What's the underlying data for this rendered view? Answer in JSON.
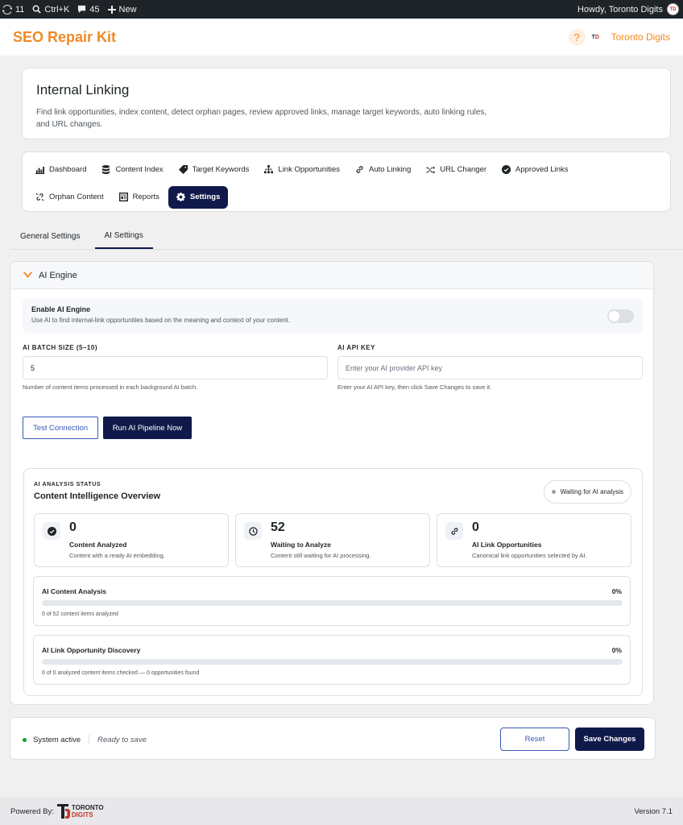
{
  "admin_bar": {
    "updates_count": "11",
    "search_label": "Ctrl+K",
    "comments_count": "45",
    "new_label": "New",
    "howdy": "Howdy, Toronto Digits"
  },
  "header": {
    "brand": "SEO Repair Kit",
    "help_glyph": "?",
    "account_name": "Toronto Digits"
  },
  "page": {
    "title": "Internal Linking",
    "description": "Find link opportunities, index content, detect orphan pages, review approved links, manage target keywords, auto linking rules, and URL changes."
  },
  "nav": {
    "row1": [
      {
        "label": "Dashboard",
        "icon": "chart-icon"
      },
      {
        "label": "Content Index",
        "icon": "database-icon"
      },
      {
        "label": "Target Keywords",
        "icon": "tag-icon"
      },
      {
        "label": "Link Opportunities",
        "icon": "sitemap-icon"
      },
      {
        "label": "Auto Linking",
        "icon": "link-icon"
      },
      {
        "label": "URL Changer",
        "icon": "shuffle-icon"
      },
      {
        "label": "Approved Links",
        "icon": "check-circle-icon"
      }
    ],
    "row2": [
      {
        "label": "Orphan Content",
        "icon": "broken-link-icon"
      },
      {
        "label": "Reports",
        "icon": "report-icon"
      },
      {
        "label": "Settings",
        "icon": "gear-icon"
      }
    ]
  },
  "subtabs": [
    "General Settings",
    "AI Settings"
  ],
  "ai_engine": {
    "heading": "AI Engine",
    "enable_title": "Enable AI Engine",
    "enable_desc": "Use AI to find internal-link opportunities based on the meaning and context of your content.",
    "enabled": false,
    "batch_label": "AI BATCH SIZE (5–10)",
    "batch_value": "5",
    "batch_help": "Number of content items processed in each background AI batch.",
    "api_label": "AI API KEY",
    "api_placeholder": "Enter your AI provider API key",
    "api_value": "",
    "api_help": "Enter your AI API key, then click Save Changes to save it.",
    "test_button": "Test Connection",
    "run_button": "Run AI Pipeline Now"
  },
  "status": {
    "kicker": "AI ANALYSIS STATUS",
    "title": "Content Intelligence Overview",
    "pill": "Waiting for AI analysis",
    "stats": [
      {
        "value": "0",
        "label": "Content Analyzed",
        "desc": "Content with a ready AI embedding.",
        "icon": "check-circle-icon"
      },
      {
        "value": "52",
        "label": "Waiting to Analyze",
        "desc": "Content still waiting for AI processing.",
        "icon": "clock-icon"
      },
      {
        "value": "0",
        "label": "AI Link Opportunities",
        "desc": "Canonical link opportunities selected by AI.",
        "icon": "link-icon"
      }
    ],
    "progress": [
      {
        "title": "AI Content Analysis",
        "percent_label": "0%",
        "fraction": 0,
        "note": "0 of 52 content items analyzed"
      },
      {
        "title": "AI Link Opportunity Discovery",
        "percent_label": "0%",
        "fraction": 0,
        "note": "0 of 0 analyzed content items checked — 0 opportunities found"
      }
    ]
  },
  "footer": {
    "system_status": "System active",
    "save_state": "Ready to save",
    "reset_button": "Reset",
    "save_button": "Save Changes"
  },
  "bottom": {
    "powered_by": "Powered By:",
    "logo_line1": "TORONTO",
    "logo_line2": "DIGITS",
    "version": "Version 7.1"
  },
  "colors": {
    "brand_orange": "#f08a24",
    "navy": "#101a4a",
    "link_blue": "#3858b5",
    "active_green": "#00a32a"
  }
}
